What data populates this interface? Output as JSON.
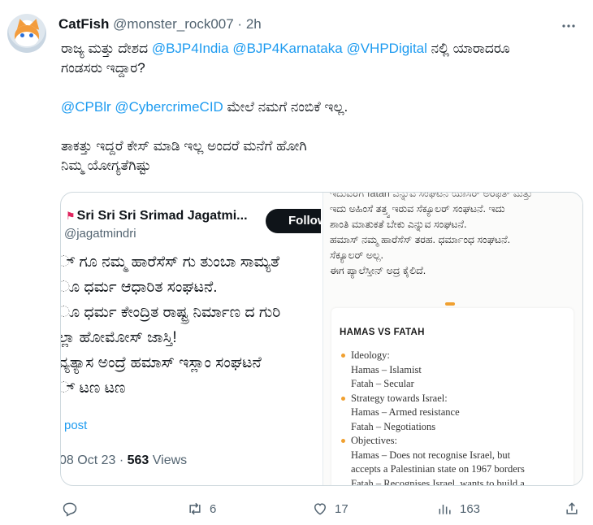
{
  "author": {
    "name": "CatFish",
    "handle": "@monster_rock007",
    "separator": "·",
    "time": "2h"
  },
  "tweet": {
    "line1_pre": "ರಾಜ್ಯ ಮತ್ತು ದೇಶದ ",
    "mention1": "@BJP4India",
    "mention2": "@BJP4Karnataka",
    "mention3": "@VHPDigital",
    "line1_post": " ನಲ್ಲಿ ಯಾರಾದರೂ",
    "line2": "ಗಂಡಸರು ಇದ್ದಾರ?",
    "mention4": "@CPBlr",
    "mention5": "@CybercrimeCID",
    "line3_post": " ಮೇಲೆ ನಮಗೆ ನಂಬಿಕೆ ಇಲ್ಲ.",
    "line4": "ತಾಕತ್ತು ಇದ್ದರೆ ಕೇಸ್ ಮಾಡಿ ಇಲ್ಲ ಅಂದರೆ ಮನೆಗೆ ಹೋಗಿ",
    "line5": "ನಿಮ್ಮ ಯೋಗ್ಯತೆಗಿಷ್ಟು"
  },
  "quoted": {
    "name": "Sri Sri Sri Srimad Jagatmi...",
    "flag_icon": "red-flag-icon",
    "handle": "@jagatmindri",
    "follow_label": "Follow",
    "body_lines": [
      "್ ಗೂ ನಮ್ಮ ಹಾರೆಸೆಸ್ ಗು ತುಂಬಾ ಸಾಮ್ಯತೆ",
      "ೂ ಧರ್ಮ ಆಧಾರಿತ ಸಂಘಟನೆ.",
      "ೂ ಧರ್ಮ ಕೇಂದ್ರಿತ ರಾಷ್ಟ್ರ ನಿರ್ಮಾಣ ದ ಗುರಿ",
      "ಲ್ಲಾ ಹೋಮೋಸ್ ಜಾಸ್ತಿ!",
      "ವ್ಯತ್ಯಾಸ ಅಂದ್ರೆ ಹಮಾಸ್ ಇಸ್ಲಾಂ ಸಂಘಟನೆ",
      "್ ಟಣ ಟಣ"
    ],
    "link_text": "post",
    "date": "08 Oct 23",
    "views_count": "563",
    "views_label": "Views"
  },
  "quoted_image": {
    "text_lines": [
      "ಇದುವರೆಗೆ fatah ಎನ್ನುವ ಸಂಘಟನೆ ಯಾಸಿರ್ ಅರಫತ್ ಮತ್ತು",
      "ಇದು ಅಹಿಂಸೆ ತತ್ತ್ವ ಇರುವ ಸೆಕ್ಯೂಲರ್ ಸಂಘಟನೆ. ಇದು",
      "ಶಾಂತಿ ಮಾತುಕತೆ ಬೇಕು ಎನ್ನುವ ಸಂಘಟನೆ.",
      "ಹಮಾಸ್ ನಮ್ಮ ಹಾರೆಸೆಸ್ ತರಹ. ಧರ್ಮಾಂಧ ಸಂಘಟನೆ.",
      "ಸೆಕ್ಯೂಲರ್ ಅಲ್ಲ.",
      "ಈಗ ಪ್ಯಾಲೆಸ್ತೀನ್ ಅದ್ರ ಕೈಲಿದೆ."
    ],
    "card_title": "HAMAS VS FATAH",
    "sections": [
      {
        "heading": "Ideology:",
        "items": [
          "Hamas – Islamist",
          "Fatah – Secular"
        ]
      },
      {
        "heading": "Strategy towards Israel:",
        "items": [
          "Hamas – Armed resistance",
          "Fatah – Negotiations"
        ]
      },
      {
        "heading": "Objectives:",
        "items": [
          "Hamas – Does not recognise Israel, but",
          "accepts a Palestinian state on 1967 borders",
          "Fatah – Recognises Israel, wants to build a"
        ]
      }
    ]
  },
  "actions": {
    "reply_icon": "reply-icon",
    "retweet_icon": "retweet-icon",
    "retweet_count": "6",
    "like_icon": "like-icon",
    "like_count": "17",
    "views_icon": "views-icon",
    "views_count": "163",
    "share_icon": "share-icon"
  }
}
